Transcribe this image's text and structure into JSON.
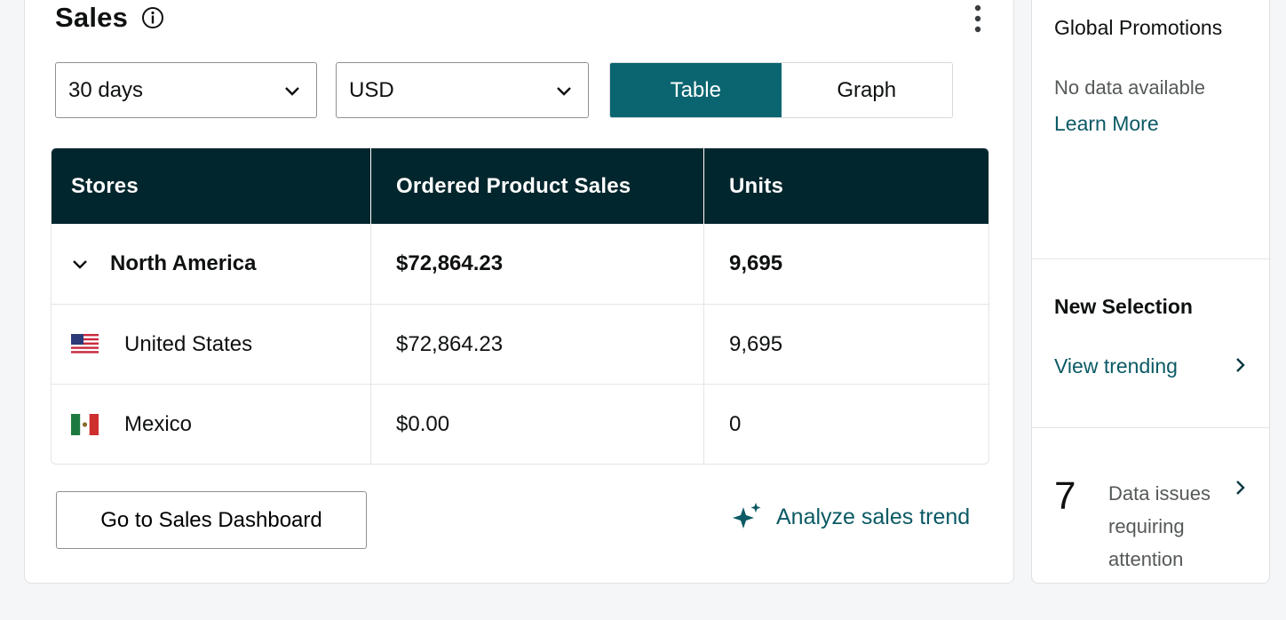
{
  "sales": {
    "title": "Sales",
    "period": "30 days",
    "currency": "USD",
    "view_toggle": {
      "table": "Table",
      "graph": "Graph",
      "active": "table"
    },
    "columns": [
      "Stores",
      "Ordered Product Sales",
      "Units"
    ],
    "rows": [
      {
        "store": "North America",
        "sales": "$72,864.23",
        "units": "9,695",
        "type": "region"
      },
      {
        "store": "United States",
        "sales": "$72,864.23",
        "units": "9,695",
        "flag": "us-flag-icon"
      },
      {
        "store": "Mexico",
        "sales": "$0.00",
        "units": "0",
        "flag": "mexico-flag-icon"
      }
    ],
    "dashboard_button": "Go to Sales Dashboard",
    "analyze_link": "Analyze sales trend"
  },
  "side": {
    "global_promotions": {
      "title": "Global Promotions",
      "status": "No data available",
      "link": "Learn More"
    },
    "new_selection": {
      "title": "New Selection",
      "link": "View trending"
    },
    "data_issues": {
      "count": "7",
      "text": "Data issues requiring attention"
    }
  },
  "colors": {
    "accent": "#0b6570",
    "header_bg": "#02262d",
    "link": "#0b5a64"
  }
}
